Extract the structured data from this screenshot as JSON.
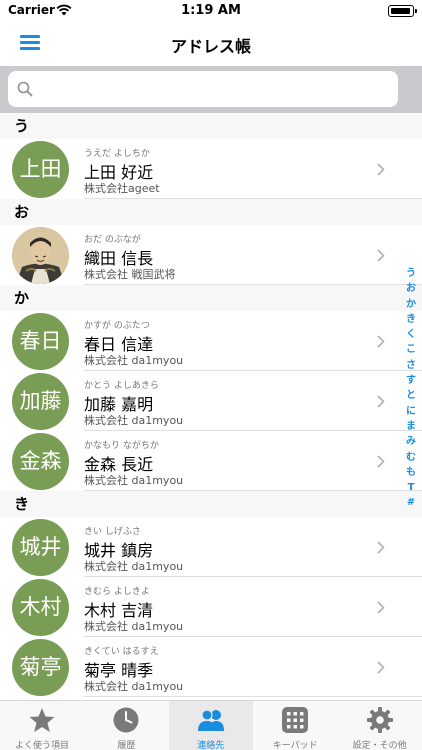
{
  "status_bar": {
    "carrier": "Carrier",
    "time": "1:19 AM",
    "battery_level": 0.95
  },
  "nav": {
    "title": "アドレス帳"
  },
  "search": {
    "placeholder": ""
  },
  "sections": [
    {
      "header": "う",
      "rows": [
        {
          "avatar_text": "上田",
          "kana": "うえだ よしちか",
          "name": "上田 好近",
          "company": "株式会社ageet"
        }
      ]
    },
    {
      "header": "お",
      "rows": [
        {
          "avatar_text": "",
          "kana": "おだ のぶなが",
          "name": "織田 信長",
          "company": "株式会社 戦国武将"
        }
      ]
    },
    {
      "header": "か",
      "rows": [
        {
          "avatar_text": "春日",
          "kana": "かすが のぶたつ",
          "name": "春日 信達",
          "company": "株式会社 da1myou"
        },
        {
          "avatar_text": "加藤",
          "kana": "かとう よしあきら",
          "name": "加藤 嘉明",
          "company": "株式会社 da1myou"
        },
        {
          "avatar_text": "金森",
          "kana": "かなもり ながちか",
          "name": "金森 長近",
          "company": "株式会社 da1myou"
        }
      ]
    },
    {
      "header": "き",
      "rows": [
        {
          "avatar_text": "城井",
          "kana": "きい しげふさ",
          "name": "城井 鎮房",
          "company": "株式会社 da1myou"
        },
        {
          "avatar_text": "木村",
          "kana": "きむら よしきよ",
          "name": "木村 吉清",
          "company": "株式会社 da1myou"
        },
        {
          "avatar_text": "菊亭",
          "kana": "きくてい はるすえ",
          "name": "菊亭 晴季",
          "company": "株式会社 da1myou"
        }
      ]
    }
  ],
  "section_index": [
    "う",
    "お",
    "か",
    "き",
    "く",
    "こ",
    "さ",
    "す",
    "と",
    "に",
    "ま",
    "み",
    "む",
    "も",
    "T",
    "#"
  ],
  "tabs": [
    {
      "label": "よく使う項目",
      "icon": "star-icon"
    },
    {
      "label": "履歴",
      "icon": "clock-icon"
    },
    {
      "label": "連絡先",
      "icon": "contacts-icon",
      "active": true
    },
    {
      "label": "キーパッド",
      "icon": "keypad-icon"
    },
    {
      "label": "設定・その他",
      "icon": "gear-icon"
    }
  ],
  "colors": {
    "accent": "#1a8de0",
    "avatar": "#7a9d55",
    "inactive": "#7a7a7a"
  }
}
